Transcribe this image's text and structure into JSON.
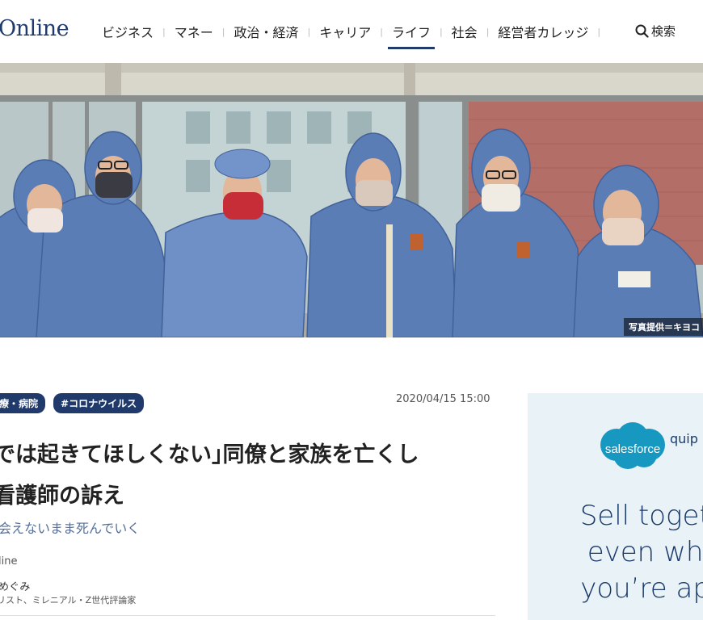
{
  "header": {
    "logo": "Online",
    "nav": [
      "ビジネス",
      "マネー",
      "政治・経済",
      "キャリア",
      "ライフ",
      "社会",
      "経営者カレッジ"
    ],
    "nav_separator": "|",
    "active_nav": "ライフ",
    "search_label": "検索"
  },
  "hero": {
    "photo_credit": "写真提供＝キヨコ"
  },
  "article": {
    "tags": [
      "療・病院",
      "#コロナウイルス"
    ],
    "date": "2020/04/15 15:00",
    "headline_line1": "では起きてほしくない｣同僚と家族を亡くし",
    "headline_line2": "看護師の訴え",
    "subhead": "会えないまま死んでいく",
    "source": "line",
    "author_name": "めぐみ",
    "author_title": "リスト、ミレニアル・Z世代評論家"
  },
  "ad": {
    "brand": "salesforce",
    "product": "quip",
    "text_lines": [
      "Sell togeth",
      "even whe",
      "you’re apa"
    ]
  },
  "colors": {
    "brand_navy": "#1f3a6b",
    "subhead_blue": "#556f99",
    "ad_background": "#e9f3f7",
    "salesforce_blue": "#1798c1"
  }
}
